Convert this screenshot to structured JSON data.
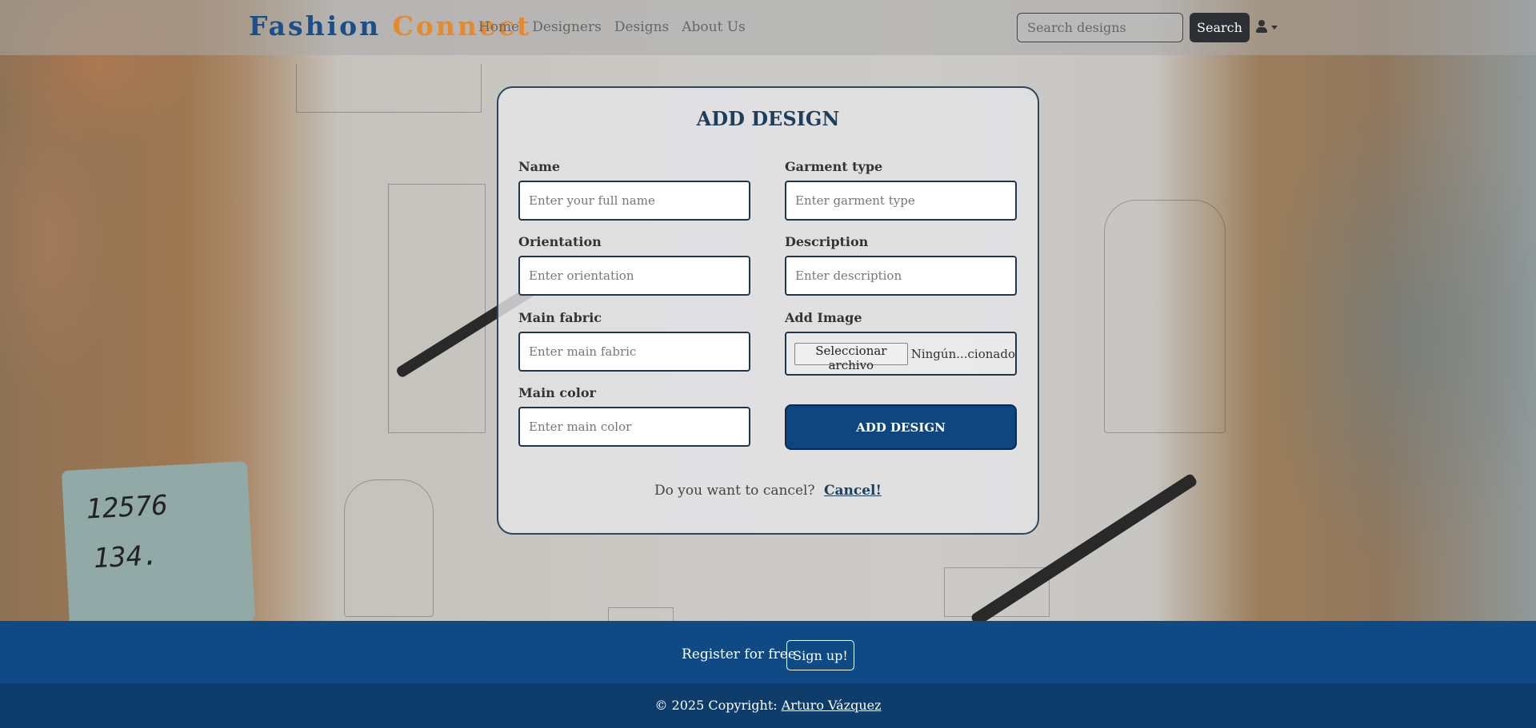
{
  "navbar": {
    "brand_part1": "Fashion",
    "brand_part2": "Connect",
    "links": [
      "Home",
      "Designers",
      "Designs",
      "About Us"
    ],
    "search_placeholder": "Search designs",
    "search_button": "Search",
    "user_icon": "user-icon"
  },
  "form": {
    "title": "ADD DESIGN",
    "fields": {
      "name": {
        "label": "Name",
        "placeholder": "Enter your full name"
      },
      "garment_type": {
        "label": "Garment type",
        "placeholder": "Enter garment type"
      },
      "orientation": {
        "label": "Orientation",
        "placeholder": "Enter orientation"
      },
      "description": {
        "label": "Description",
        "placeholder": "Enter description"
      },
      "main_fabric": {
        "label": "Main fabric",
        "placeholder": "Enter main fabric"
      },
      "add_image": {
        "label": "Add Image",
        "button": "Seleccionar archivo",
        "file_name": "Ningún...cionado"
      },
      "main_color": {
        "label": "Main color",
        "placeholder": "Enter main color"
      }
    },
    "submit_label": "ADD DESIGN",
    "cancel_question": "Do you want to cancel?",
    "cancel_link": "Cancel!"
  },
  "footer": {
    "register_text": "Register for free",
    "signup_button": "Sign up!",
    "copyright_prefix": "© 2025 Copyright:",
    "copyright_author": "Arturo Vázquez"
  },
  "colors": {
    "brand_blue": "#1b4f8a",
    "brand_orange": "#e58a2e",
    "primary_button": "#0f4680",
    "footer_top": "#104a85",
    "footer_bottom": "#0e3c6b"
  }
}
